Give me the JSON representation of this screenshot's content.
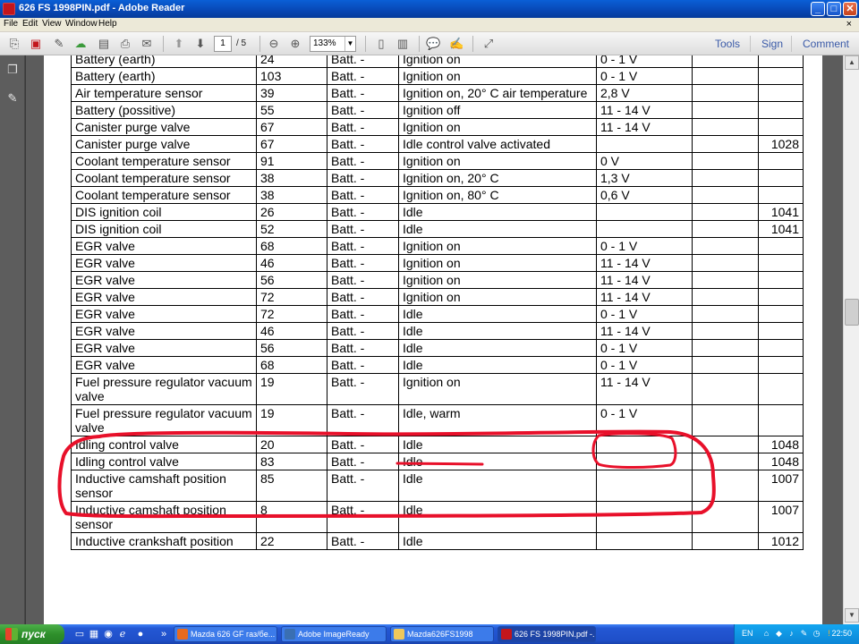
{
  "window": {
    "title": "626 FS 1998PIN.pdf - Adobe Reader",
    "controls": {
      "minimize": "_",
      "maximize": "□",
      "close": "✕"
    }
  },
  "menu": {
    "items": [
      "File",
      "Edit",
      "View",
      "Window",
      "Help"
    ],
    "close": "×"
  },
  "toolbar": {
    "page_current": "1",
    "page_total": "/ 5",
    "zoom": "133%",
    "right_links": [
      "Tools",
      "Sign",
      "Comment"
    ]
  },
  "table": {
    "rows": [
      [
        "Battery (earth)",
        "24",
        "Batt. -",
        "Ignition on",
        "0 - 1 V",
        "",
        ""
      ],
      [
        "Battery (earth)",
        "103",
        "Batt. -",
        "Ignition on",
        "0 - 1 V",
        "",
        ""
      ],
      [
        "Air temperature sensor",
        "39",
        "Batt. -",
        "Ignition on, 20° C air temperature",
        "2,8 V",
        "",
        ""
      ],
      [
        "Battery (possitive)",
        "55",
        "Batt. -",
        "Ignition off",
        "11 - 14 V",
        "",
        ""
      ],
      [
        "Canister purge valve",
        "67",
        "Batt. -",
        "Ignition on",
        "11 - 14 V",
        "",
        ""
      ],
      [
        "Canister purge valve",
        "67",
        "Batt. -",
        "Idle control valve activated",
        "",
        "",
        "1028"
      ],
      [
        "Coolant temperature sensor",
        "91",
        "Batt. -",
        "Ignition on",
        "0 V",
        "",
        ""
      ],
      [
        "Coolant temperature sensor",
        "38",
        "Batt. -",
        "Ignition on, 20° C",
        "1,3 V",
        "",
        ""
      ],
      [
        "Coolant temperature sensor",
        "38",
        "Batt. -",
        "Ignition on, 80° C",
        "0,6 V",
        "",
        ""
      ],
      [
        "DIS ignition coil",
        "26",
        "Batt. -",
        "Idle",
        "",
        "",
        "1041"
      ],
      [
        "DIS ignition coil",
        "52",
        "Batt. -",
        "Idle",
        "",
        "",
        "1041"
      ],
      [
        "EGR valve",
        "68",
        "Batt. -",
        "Ignition on",
        "0 - 1 V",
        "",
        ""
      ],
      [
        "EGR valve",
        "46",
        "Batt. -",
        "Ignition on",
        "11 - 14 V",
        "",
        ""
      ],
      [
        "EGR valve",
        "56",
        "Batt. -",
        "Ignition on",
        "11 - 14 V",
        "",
        ""
      ],
      [
        "EGR valve",
        "72",
        "Batt. -",
        "Ignition on",
        "11 - 14 V",
        "",
        ""
      ],
      [
        "EGR valve",
        "72",
        "Batt. -",
        "Idle",
        "0 - 1 V",
        "",
        ""
      ],
      [
        "EGR valve",
        "46",
        "Batt. -",
        "Idle",
        "11 - 14 V",
        "",
        ""
      ],
      [
        "EGR valve",
        "56",
        "Batt. -",
        "Idle",
        "0 - 1 V",
        "",
        ""
      ],
      [
        "EGR valve",
        "68",
        "Batt. -",
        "Idle",
        "0 - 1 V",
        "",
        ""
      ],
      [
        "Fuel pressure regulator vacuum valve",
        "19",
        "Batt. -",
        "Ignition on",
        "11 - 14 V",
        "",
        ""
      ],
      [
        "Fuel pressure regulator vacuum valve",
        "19",
        "Batt. -",
        "Idle, warm",
        "0 - 1 V",
        "",
        ""
      ],
      [
        "Idling control valve",
        "20",
        "Batt. -",
        "Idle",
        "",
        "",
        "1048"
      ],
      [
        "Idling control valve",
        "83",
        "Batt. -",
        "Idle",
        "",
        "",
        "1048"
      ],
      [
        "Inductive camshaft position sensor",
        "85",
        "Batt. -",
        "Idle",
        "",
        "",
        "1007"
      ],
      [
        "Inductive camshaft position sensor",
        "8",
        "Batt. -",
        "Idle",
        "",
        "",
        "1007"
      ],
      [
        "Inductive crankshaft position",
        "22",
        "Batt. -",
        "Idle",
        "",
        "",
        "1012"
      ]
    ]
  },
  "taskbar": {
    "start_label": "пуск",
    "tasks": [
      "Mazda 626 GF газ/бе...",
      "Adobe ImageReady",
      "Mazda626FS1998",
      "626 FS 1998PIN.pdf -..."
    ],
    "language": "EN",
    "clock": "22:50"
  },
  "colors": {
    "annotation": "#e8102a",
    "titlebar": "#0a5fd6",
    "taskbar": "#2458d4",
    "start": "#2e8f2b"
  }
}
